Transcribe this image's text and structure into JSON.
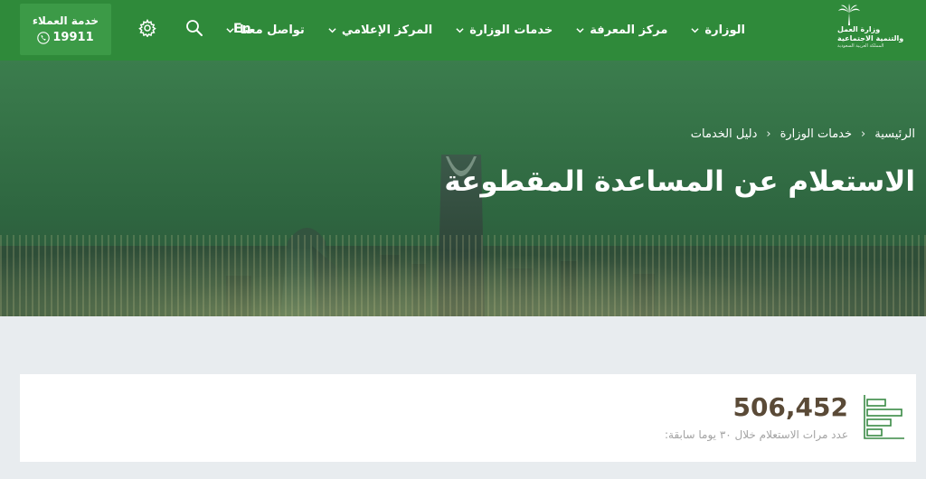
{
  "logo": {
    "line1": "وزارة العمل",
    "line2": "والتنمية الاجتماعية",
    "line3": "المملكة العربية السعودية"
  },
  "nav": {
    "items": [
      {
        "label": "الوزارة"
      },
      {
        "label": "مركز المعرفة"
      },
      {
        "label": "خدمات الوزارة"
      },
      {
        "label": "المركز الإعلامي"
      },
      {
        "label": "تواصل معنا"
      }
    ],
    "language": "En"
  },
  "customer_service": {
    "title": "خدمة العملاء",
    "phone": "19911"
  },
  "breadcrumb": {
    "items": [
      "الرئيسية",
      "خدمات الوزارة",
      "دليل الخدمات"
    ]
  },
  "page_title": "الاستعلام عن المساعدة المقطوعة",
  "stats": {
    "value": "506,452",
    "label": "عدد مرات الاستعلام خلال ٣٠ يوما سابقة:"
  },
  "colors": {
    "header": "#2f8a3a",
    "accent": "#3c9a47",
    "stat_value": "#5a4a37"
  }
}
